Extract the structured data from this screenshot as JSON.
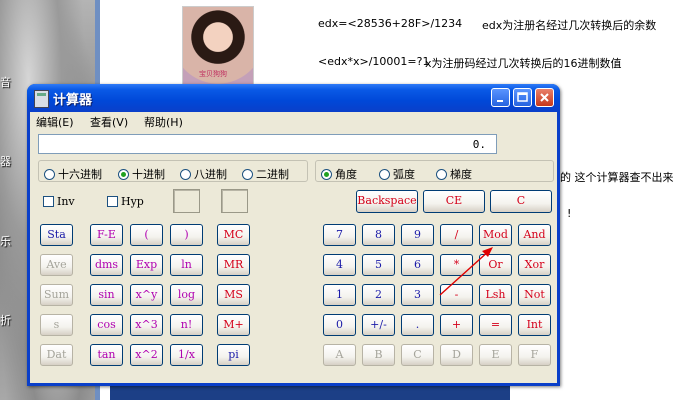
{
  "desktop": {
    "labels": [
      "音",
      "器",
      "乐",
      "折"
    ]
  },
  "document": {
    "photo_caption": "宝贝狗狗",
    "line1_formula": "edx=<28536+28F>/1234",
    "line1_note": "edx为注册名经过几次转换后的余数",
    "line2_formula": "<edx*x>/10001=?1",
    "line2_note": "x为注册码经过几次转换后的16进制数值",
    "line3": "的  这个计算器查不出来",
    "line4": "!"
  },
  "calculator": {
    "title": "计算器",
    "menu": [
      "编辑(E)",
      "查看(V)",
      "帮助(H)"
    ],
    "display_value": "0.",
    "bases": [
      "十六进制",
      "十进制",
      "八进制",
      "二进制"
    ],
    "selected_base": "十进制",
    "angles": [
      "角度",
      "弧度",
      "梯度"
    ],
    "selected_angle": "角度",
    "inv_label": "Inv",
    "hyp_label": "Hyp",
    "edit_keys": [
      "Backspace",
      "CE",
      "C"
    ],
    "memory_keys": [
      "MC",
      "MR",
      "MS",
      "M+"
    ],
    "function_keys": [
      [
        "Sta",
        "F-E",
        "(",
        ")"
      ],
      [
        "Ave",
        "dms",
        "Exp",
        "ln"
      ],
      [
        "Sum",
        "sin",
        "x^y",
        "log"
      ],
      [
        "s",
        "cos",
        "x^3",
        "n!"
      ],
      [
        "Dat",
        "tan",
        "x^2",
        "1/x"
      ]
    ],
    "pi_label": "pi",
    "keypad": [
      [
        "7",
        "8",
        "9",
        "/",
        "Mod",
        "And"
      ],
      [
        "4",
        "5",
        "6",
        "*",
        "Or",
        "Xor"
      ],
      [
        "1",
        "2",
        "3",
        "-",
        "Lsh",
        "Not"
      ],
      [
        "0",
        "+/-",
        ".",
        "+",
        "=",
        "Int"
      ],
      [
        "A",
        "B",
        "C",
        "D",
        "E",
        "F"
      ]
    ],
    "colors": {
      "title_bar": "#0a3fc9",
      "client_bg": "#ece9d8",
      "red_text": "#d4001a",
      "blue_text": "#1a1aa8",
      "magenta_text": "#b000b0",
      "arrow": "#e00000"
    }
  }
}
